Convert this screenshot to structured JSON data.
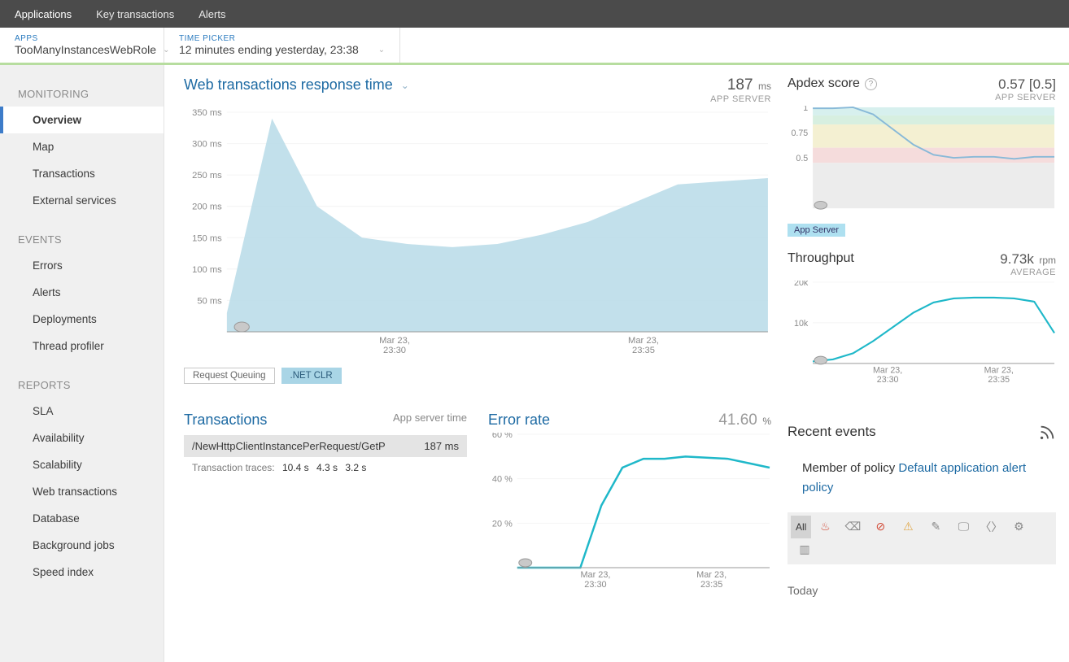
{
  "topnav": {
    "items": [
      "Applications",
      "Key transactions",
      "Alerts"
    ],
    "active": 0
  },
  "selector": {
    "apps_label": "APPS",
    "app_name": "TooManyInstancesWebRole",
    "time_label": "TIME PICKER",
    "time_value": "12 minutes ending yesterday, 23:38"
  },
  "sidebar": {
    "sections": [
      {
        "title": "MONITORING",
        "items": [
          "Overview",
          "Map",
          "Transactions",
          "External services"
        ],
        "active": 0
      },
      {
        "title": "EVENTS",
        "items": [
          "Errors",
          "Alerts",
          "Deployments",
          "Thread profiler"
        ]
      },
      {
        "title": "REPORTS",
        "items": [
          "SLA",
          "Availability",
          "Scalability",
          "Web transactions",
          "Database",
          "Background jobs",
          "Speed index"
        ]
      }
    ]
  },
  "response_time": {
    "title": "Web transactions response time",
    "value": "187",
    "unit": "ms",
    "sub": "APP SERVER",
    "legend": [
      {
        "label": "Request Queuing",
        "active": false
      },
      {
        "label": ".NET CLR",
        "active": true
      }
    ]
  },
  "apdex": {
    "title": "Apdex score",
    "value": "0.57 [0.5]",
    "sub": "APP SERVER",
    "badge": "App Server"
  },
  "throughput": {
    "title": "Throughput",
    "value": "9.73k",
    "unit": "rpm",
    "sub": "AVERAGE"
  },
  "transactions": {
    "title": "Transactions",
    "right": "App server time",
    "row_name": "/NewHttpClientInstancePerRequest/GetP",
    "row_val": "187 ms",
    "trace_label": "Transaction traces:",
    "traces": [
      "10.4 s",
      "4.3 s",
      "3.2 s"
    ]
  },
  "error_rate": {
    "title": "Error rate",
    "value": "41.60",
    "unit": "%"
  },
  "recent": {
    "title": "Recent events",
    "policy_prefix": "Member of policy ",
    "policy_link": "Default application alert policy",
    "filter_all": "All",
    "today": "Today"
  },
  "chart_data": [
    {
      "name": "web_response_time",
      "type": "area",
      "ylabel": "ms",
      "ylim": [
        0,
        350
      ],
      "yticks": [
        50,
        100,
        150,
        200,
        250,
        300,
        350
      ],
      "xlabels": [
        "Mar 23,\n23:30",
        "Mar 23,\n23:35"
      ],
      "x": [
        0,
        1,
        2,
        3,
        4,
        5,
        6,
        7,
        8,
        9,
        10,
        11,
        12
      ],
      "values": [
        30,
        340,
        200,
        150,
        140,
        135,
        140,
        155,
        175,
        205,
        235,
        240,
        245
      ]
    },
    {
      "name": "apdex",
      "type": "line",
      "ylim": [
        0,
        1
      ],
      "yticks": [
        0.5,
        0.75,
        1
      ],
      "bands": [
        {
          "from": 0.92,
          "to": 1.0,
          "color": "#d7f0ee"
        },
        {
          "from": 0.83,
          "to": 0.92,
          "color": "#d7efe0"
        },
        {
          "from": 0.6,
          "to": 0.83,
          "color": "#f4f0d2"
        },
        {
          "from": 0.45,
          "to": 0.6,
          "color": "#f5dcdc"
        },
        {
          "from": 0.0,
          "to": 0.45,
          "color": "#ececec"
        }
      ],
      "x": [
        0,
        1,
        2,
        3,
        4,
        5,
        6,
        7,
        8,
        9,
        10,
        11,
        12
      ],
      "values": [
        0.99,
        0.99,
        1.0,
        0.93,
        0.78,
        0.63,
        0.53,
        0.5,
        0.51,
        0.51,
        0.49,
        0.51,
        0.51
      ]
    },
    {
      "name": "throughput",
      "type": "line",
      "ylim": [
        0,
        20000
      ],
      "yticks": [
        10000,
        20000
      ],
      "ytick_labels": [
        "10k",
        "20k"
      ],
      "xlabels": [
        "Mar 23,\n23:30",
        "Mar 23,\n23:35"
      ],
      "x": [
        0,
        1,
        2,
        3,
        4,
        5,
        6,
        7,
        8,
        9,
        10,
        11,
        12
      ],
      "values": [
        500,
        1000,
        2500,
        5500,
        9000,
        12500,
        15000,
        16000,
        16200,
        16200,
        16000,
        15200,
        7500
      ]
    },
    {
      "name": "error_rate",
      "type": "line",
      "ylabel": "%",
      "ylim": [
        0,
        60
      ],
      "yticks": [
        20,
        40,
        60
      ],
      "xlabels": [
        "Mar 23,\n23:30",
        "Mar 23,\n23:35"
      ],
      "x": [
        0,
        1,
        2,
        3,
        4,
        5,
        6,
        7,
        8,
        9,
        10,
        11,
        12
      ],
      "values": [
        0,
        0,
        0,
        0,
        28,
        45,
        49,
        49,
        50,
        49.5,
        49,
        47,
        45
      ]
    }
  ]
}
